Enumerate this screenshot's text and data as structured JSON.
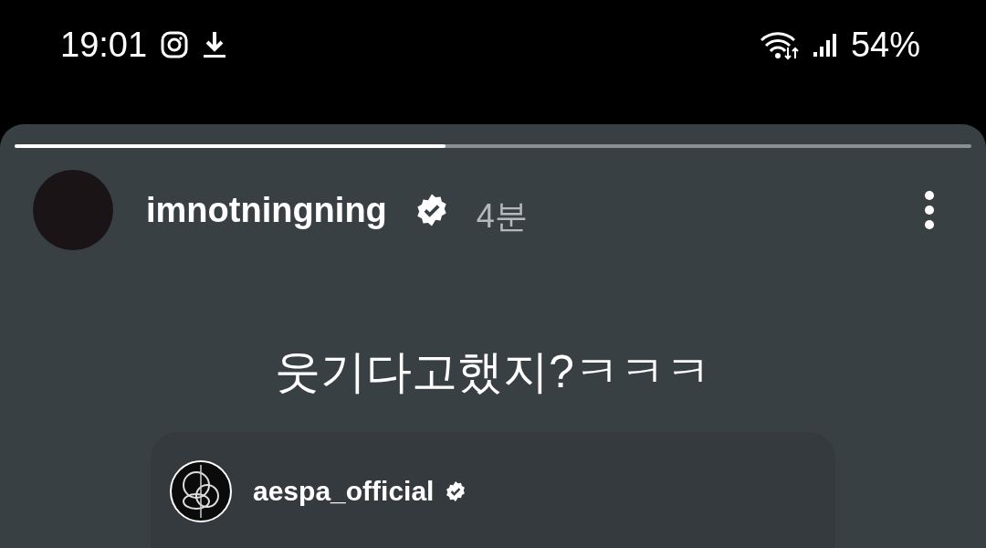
{
  "status_bar": {
    "time": "19:01",
    "battery": "54%"
  },
  "story": {
    "progress": {
      "level": 0.45
    },
    "user": {
      "username": "imnotningning",
      "verified": true,
      "time": "4분"
    },
    "caption": "웃기다고했지?ㅋㅋㅋ",
    "shared_post": {
      "username": "aespa_official",
      "verified": true
    }
  }
}
